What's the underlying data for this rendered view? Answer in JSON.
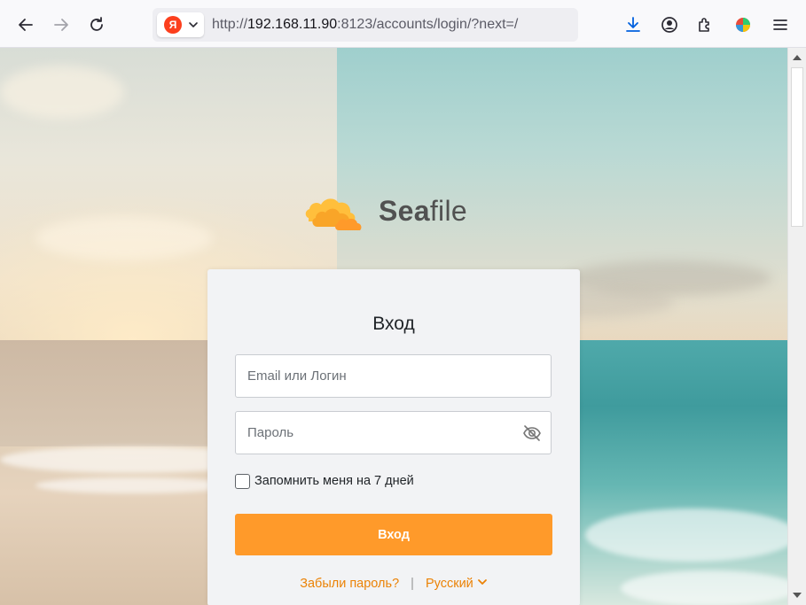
{
  "browser": {
    "address_prefix": "http://",
    "address_host": "192.168.11.90",
    "address_rest": ":8123/accounts/login/?next=/",
    "site_chip_letter": "Я",
    "icons": [
      "back-icon",
      "forward-icon",
      "reload-icon",
      "yandex-icon",
      "chevron-down-icon",
      "download-icon",
      "account-icon",
      "extensions-icon",
      "profile-avatar-icon",
      "menu-icon"
    ]
  },
  "logo": {
    "text_bold": "Sea",
    "text_regular": "file"
  },
  "login": {
    "title": "Вход",
    "email_placeholder": "Email или Логин",
    "email_value": "",
    "password_placeholder": "Пароль",
    "password_value": "",
    "remember_label": "Запомнить меня на 7 дней",
    "remember_checked": false,
    "submit_label": "Вход",
    "forgot_link": "Забыли пароль?",
    "separator": "|",
    "language": "Русский"
  },
  "colors": {
    "accent": "#ff9a2a",
    "link": "#eb8205",
    "card_bg": "#f2f3f5"
  }
}
